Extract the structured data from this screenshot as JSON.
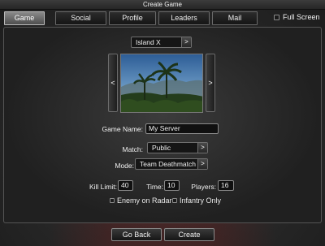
{
  "window": {
    "title": "Create Game"
  },
  "tabs": [
    {
      "label": "Game",
      "active": true
    },
    {
      "label": "Social",
      "active": false
    },
    {
      "label": "Profile",
      "active": false
    },
    {
      "label": "Leaders",
      "active": false
    },
    {
      "label": "Mail",
      "active": false
    }
  ],
  "fullscreen": {
    "label": "Full Screen",
    "checked": false
  },
  "map": {
    "name": "Island X",
    "next": ">",
    "prev_side": "<",
    "next_side": ">"
  },
  "form": {
    "game_name_label": "Game Name:",
    "game_name_value": "My Server",
    "match_label": "Match:",
    "match_value": "Public",
    "mode_label": "Mode:",
    "mode_value": "Team Deathmatch",
    "kill_limit_label": "Kill Limit:",
    "kill_limit_value": "40",
    "time_label": "Time:",
    "time_value": "10",
    "players_label": "Players:",
    "players_value": "16",
    "enemy_radar_label": "Enemy on Radar",
    "infantry_only_label": "Infantry Only",
    "arrow": ">"
  },
  "buttons": {
    "go_back": "Go Back",
    "create": "Create"
  },
  "colors": {
    "active_tab": "#7a7a7a",
    "panel_border": "#555555",
    "sky": "#4a7ab0",
    "foliage": "#2e4a22"
  }
}
